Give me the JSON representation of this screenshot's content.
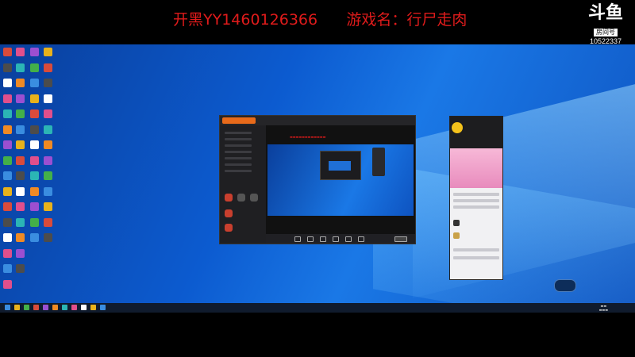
{
  "overlay": {
    "title": "开黑YY1460126366      游戏名：行尸走肉",
    "logo_top": "斗鱼",
    "logo_badge": "房间号",
    "room_number": "10522337"
  },
  "colors": {
    "overlay_title": "#e01b1b",
    "desktop_blue": "#0c5bd0",
    "app_accent": "#e86a1a",
    "app_button_red": "#c93f2e",
    "phone_banner_pink": "#e88bbd",
    "avatar_yellow": "#f4c21b"
  },
  "icons": {
    "desktop": "desktop-shortcut-icons",
    "streaming_app": "streaming-app-window",
    "phone_window": "phone-mirror-window",
    "tray": "taskbar-tray-icon"
  }
}
